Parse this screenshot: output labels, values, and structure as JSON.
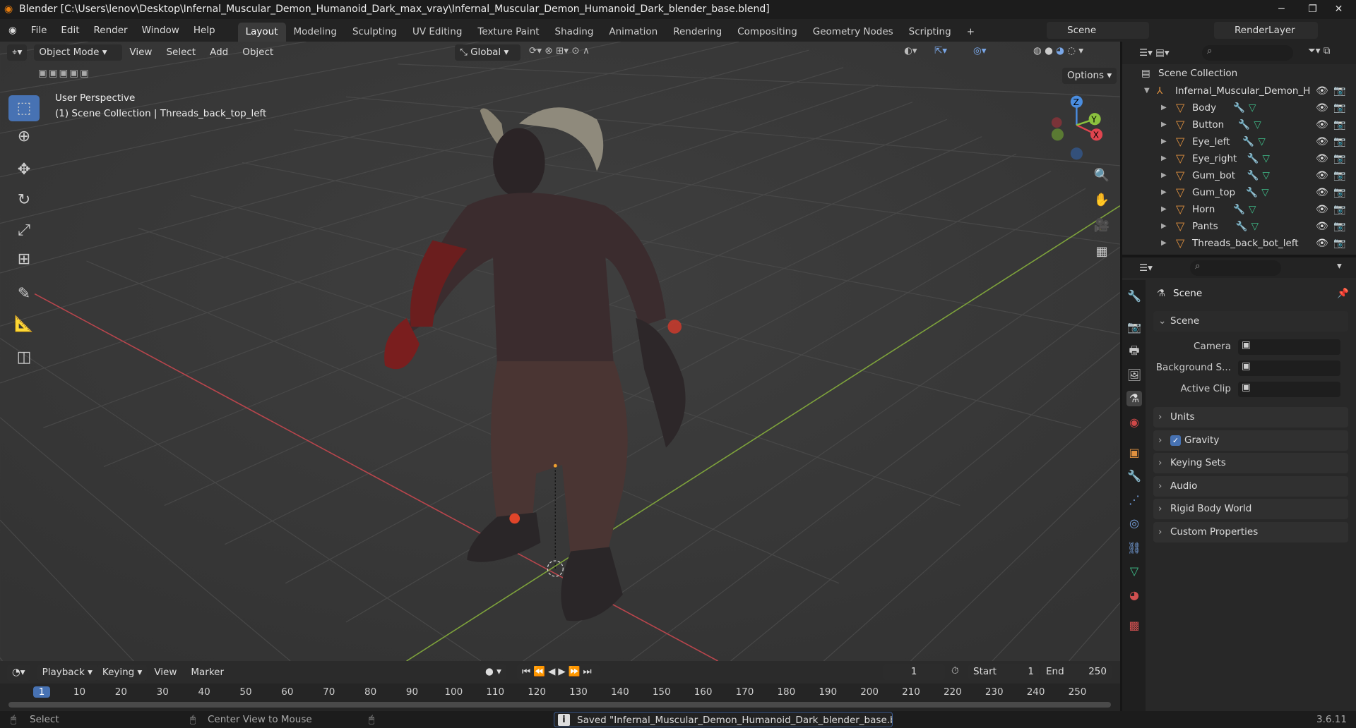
{
  "window": {
    "title": "Blender [C:\\Users\\lenov\\Desktop\\Infernal_Muscular_Demon_Humanoid_Dark_max_vray\\Infernal_Muscular_Demon_Humanoid_Dark_blender_base.blend]",
    "minimize": "─",
    "maximize": "❐",
    "close": "✕"
  },
  "menus": [
    "File",
    "Edit",
    "Render",
    "Window",
    "Help"
  ],
  "workspaces": [
    "Layout",
    "Modeling",
    "Sculpting",
    "UV Editing",
    "Texture Paint",
    "Shading",
    "Animation",
    "Rendering",
    "Compositing",
    "Geometry Nodes",
    "Scripting",
    "+"
  ],
  "scene": {
    "name": "Scene",
    "view_layer": "RenderLayer"
  },
  "viewport": {
    "mode": "Object Mode",
    "menus": [
      "View",
      "Select",
      "Add",
      "Object"
    ],
    "orientation": "Global",
    "options": "Options",
    "overlay_title": "User Perspective",
    "overlay_subtitle": "(1) Scene Collection | Threads_back_top_left",
    "gizmo": {
      "x": "X",
      "y": "Y",
      "z": "Z"
    }
  },
  "tools": [
    "select-box",
    "cursor",
    "move",
    "rotate",
    "scale",
    "transform",
    "annotate",
    "measure",
    "add-cube"
  ],
  "outliner": {
    "root": "Scene Collection",
    "collection": "Infernal_Muscular_Demon_H",
    "objects": [
      "Body",
      "Button",
      "Eye_left",
      "Eye_right",
      "Gum_bot",
      "Gum_top",
      "Horn",
      "Pants",
      "Threads_back_bot_left"
    ]
  },
  "properties": {
    "context": "Scene",
    "section": "Scene",
    "fields": [
      {
        "label": "Camera",
        "value": ""
      },
      {
        "label": "Background S...",
        "value": ""
      },
      {
        "label": "Active Clip",
        "value": ""
      }
    ],
    "panels": [
      "Units",
      "Gravity",
      "Keying Sets",
      "Audio",
      "Rigid Body World",
      "Custom Properties"
    ],
    "gravity_checked": true
  },
  "timeline": {
    "menus": [
      "Playback",
      "Keying",
      "View",
      "Marker"
    ],
    "current_frame": "1",
    "start_label": "Start",
    "start": "1",
    "end_label": "End",
    "end": "250",
    "ticks": [
      "1",
      "10",
      "20",
      "30",
      "40",
      "50",
      "60",
      "70",
      "80",
      "90",
      "100",
      "110",
      "120",
      "130",
      "140",
      "150",
      "160",
      "170",
      "180",
      "190",
      "200",
      "210",
      "220",
      "230",
      "240",
      "250"
    ]
  },
  "statusbar": {
    "select": "Select",
    "center": "Center View to Mouse",
    "message": "Saved \"Infernal_Muscular_Demon_Humanoid_Dark_blender_base.blend\"",
    "version": "3.6.11"
  },
  "colors": {
    "accent": "#4772b3",
    "x_axis": "#e0454f",
    "y_axis": "#8bc13e",
    "z_axis": "#4a8de0",
    "mesh": "#e0913f"
  }
}
